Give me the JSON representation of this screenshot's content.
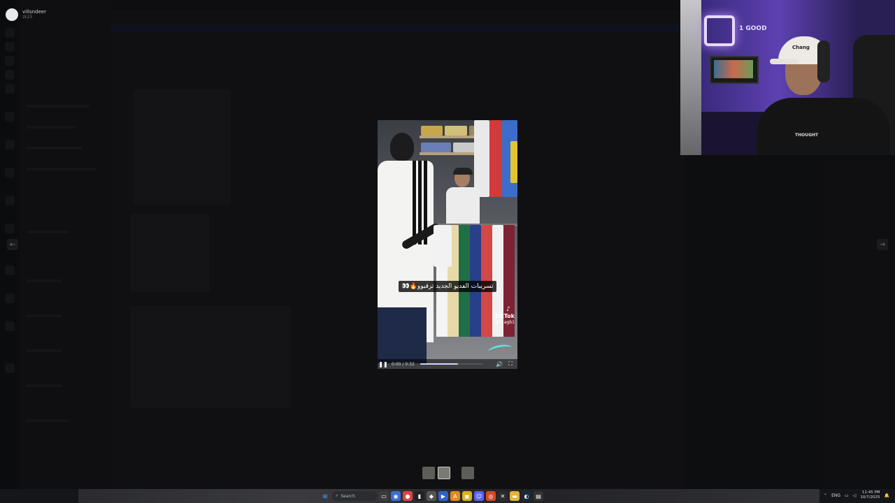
{
  "user": {
    "name": "villsndeer",
    "status": "zk25"
  },
  "media": {
    "caption": "تسريبات الفديو الجديد ترقبوو🔥👀",
    "watermark": "TikTok",
    "handle": "@ n.agb1",
    "time": "0:00 / 0:32",
    "progress": 0.6
  },
  "thumbnails": [
    "thumb-1",
    "thumb-2",
    "thumb-3"
  ],
  "webcam": {
    "sign": "1 GOOD",
    "cap_text": "Chang",
    "shirt_text": "THOUGHT"
  },
  "taskbar": {
    "search_label": "Search",
    "lang": "ENG",
    "time": "11:45 PM",
    "date": "10/7/2025"
  },
  "colors": {
    "accent": "#5fe0d8",
    "progress": "#cfd3ff"
  }
}
